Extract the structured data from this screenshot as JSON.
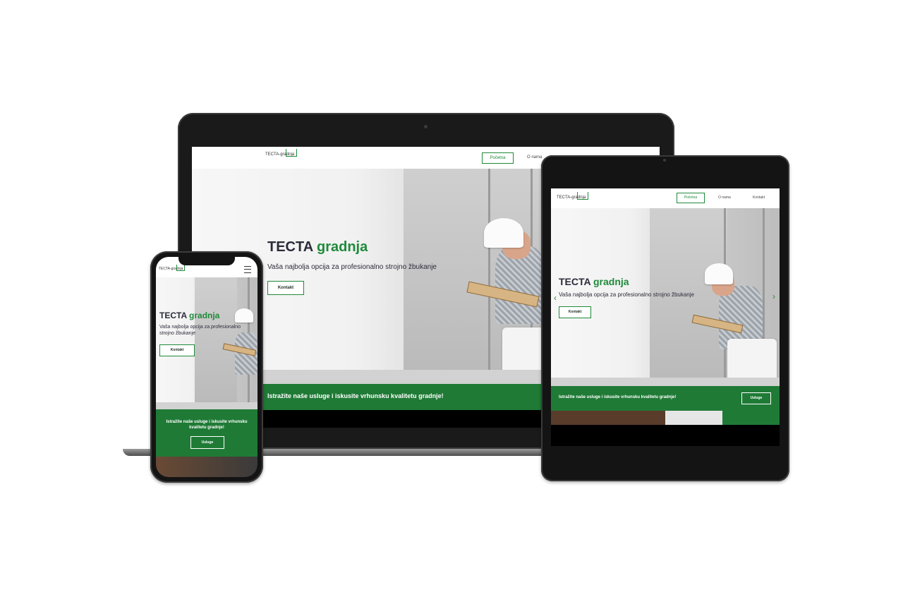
{
  "site": {
    "logo_text": "TECTA-gradnja",
    "nav": [
      "Početna",
      "O nama",
      "Kontakt"
    ],
    "hero_title_dark": "TECTA",
    "hero_title_green": "gradnja",
    "hero_subtitle": "Vaša najbolja opcija za profesionalno strojno žbukanje",
    "hero_button": "Kontakt",
    "band_text": "Istražite naše usluge i iskusite vrhunsku kvalitetu gradnje!",
    "band_button": "Usluge"
  },
  "colors": {
    "accent": "#1f8a3a",
    "band": "#1f7a36",
    "device_frame": "#141414"
  }
}
